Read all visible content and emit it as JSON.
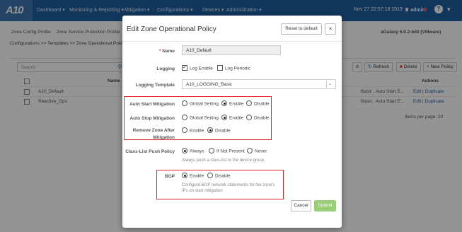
{
  "topnav": {
    "logo": "A10",
    "items": [
      "Dashboard ▾",
      "Monitoring & Reporting ▾",
      "Mitigation ▾",
      "Configurations ▾",
      "Devices ▾",
      "Administration ▾"
    ],
    "datetime": "Nov 27 22:57:18 2019",
    "user": "admin",
    "help": "?",
    "more": "▾"
  },
  "background": {
    "tabs": [
      "Zone Config Profile",
      "Zone Service Protection Profile"
    ],
    "breadcrumb": "Configurations >> Templates >> Zone Operational Policy",
    "version": "aGalaxy 5.0.2-b40 (VMware)",
    "search_placeholder": "Search",
    "table_header_name": "Name",
    "table_header_actions": "Actions",
    "rows": [
      {
        "name": "A10_Default",
        "detail": "Basic , Auto Start E...",
        "actions": "Edit | Duplicate"
      },
      {
        "name": "Reactive_Ops",
        "detail": "Basic , Auto Start E...",
        "actions": "Edit | Duplicate"
      }
    ],
    "buttons": {
      "export": "rt",
      "refresh": "Refresh",
      "delete": "Delete",
      "new": "+ New Policy"
    },
    "items_per_page": "Items per page: 20"
  },
  "modal": {
    "title": "Edit Zone Operational Policy",
    "reset": "Reset to default",
    "close": "×",
    "fields": {
      "name_label": "Name",
      "name_req": "* ",
      "name_value": "A10_Default",
      "logging_label": "Logging",
      "logging_enable": "Log Enable",
      "logging_periodic": "Log Periodic",
      "template_label": "Logging Template",
      "template_value": "A10_LOGGING_Basic",
      "auto_start_label": "Auto Start Mitigation",
      "auto_stop_label": "Auto Stop Mitigation",
      "remove_zone_label": "Remove Zone After Mitigation",
      "opt_global": "Global Setting",
      "opt_enable": "Enable",
      "opt_disable": "Disable",
      "class_list_label": "Class-List Push Policy",
      "opt_always": "Always",
      "opt_if_not_present": "If Not Present",
      "opt_never": "Never",
      "class_list_help": "Always push a class-list to the device group.",
      "bgp_label": "BGP",
      "bgp_help_1": "Configure BGP network statements for the zone's",
      "bgp_help_2": "IPs on start mitigation"
    },
    "cancel": "Cancel",
    "submit": "Submit"
  },
  "colors": {
    "nav": "#1f5fa0",
    "highlight": "#e0242a",
    "submit": "#9acd78"
  }
}
